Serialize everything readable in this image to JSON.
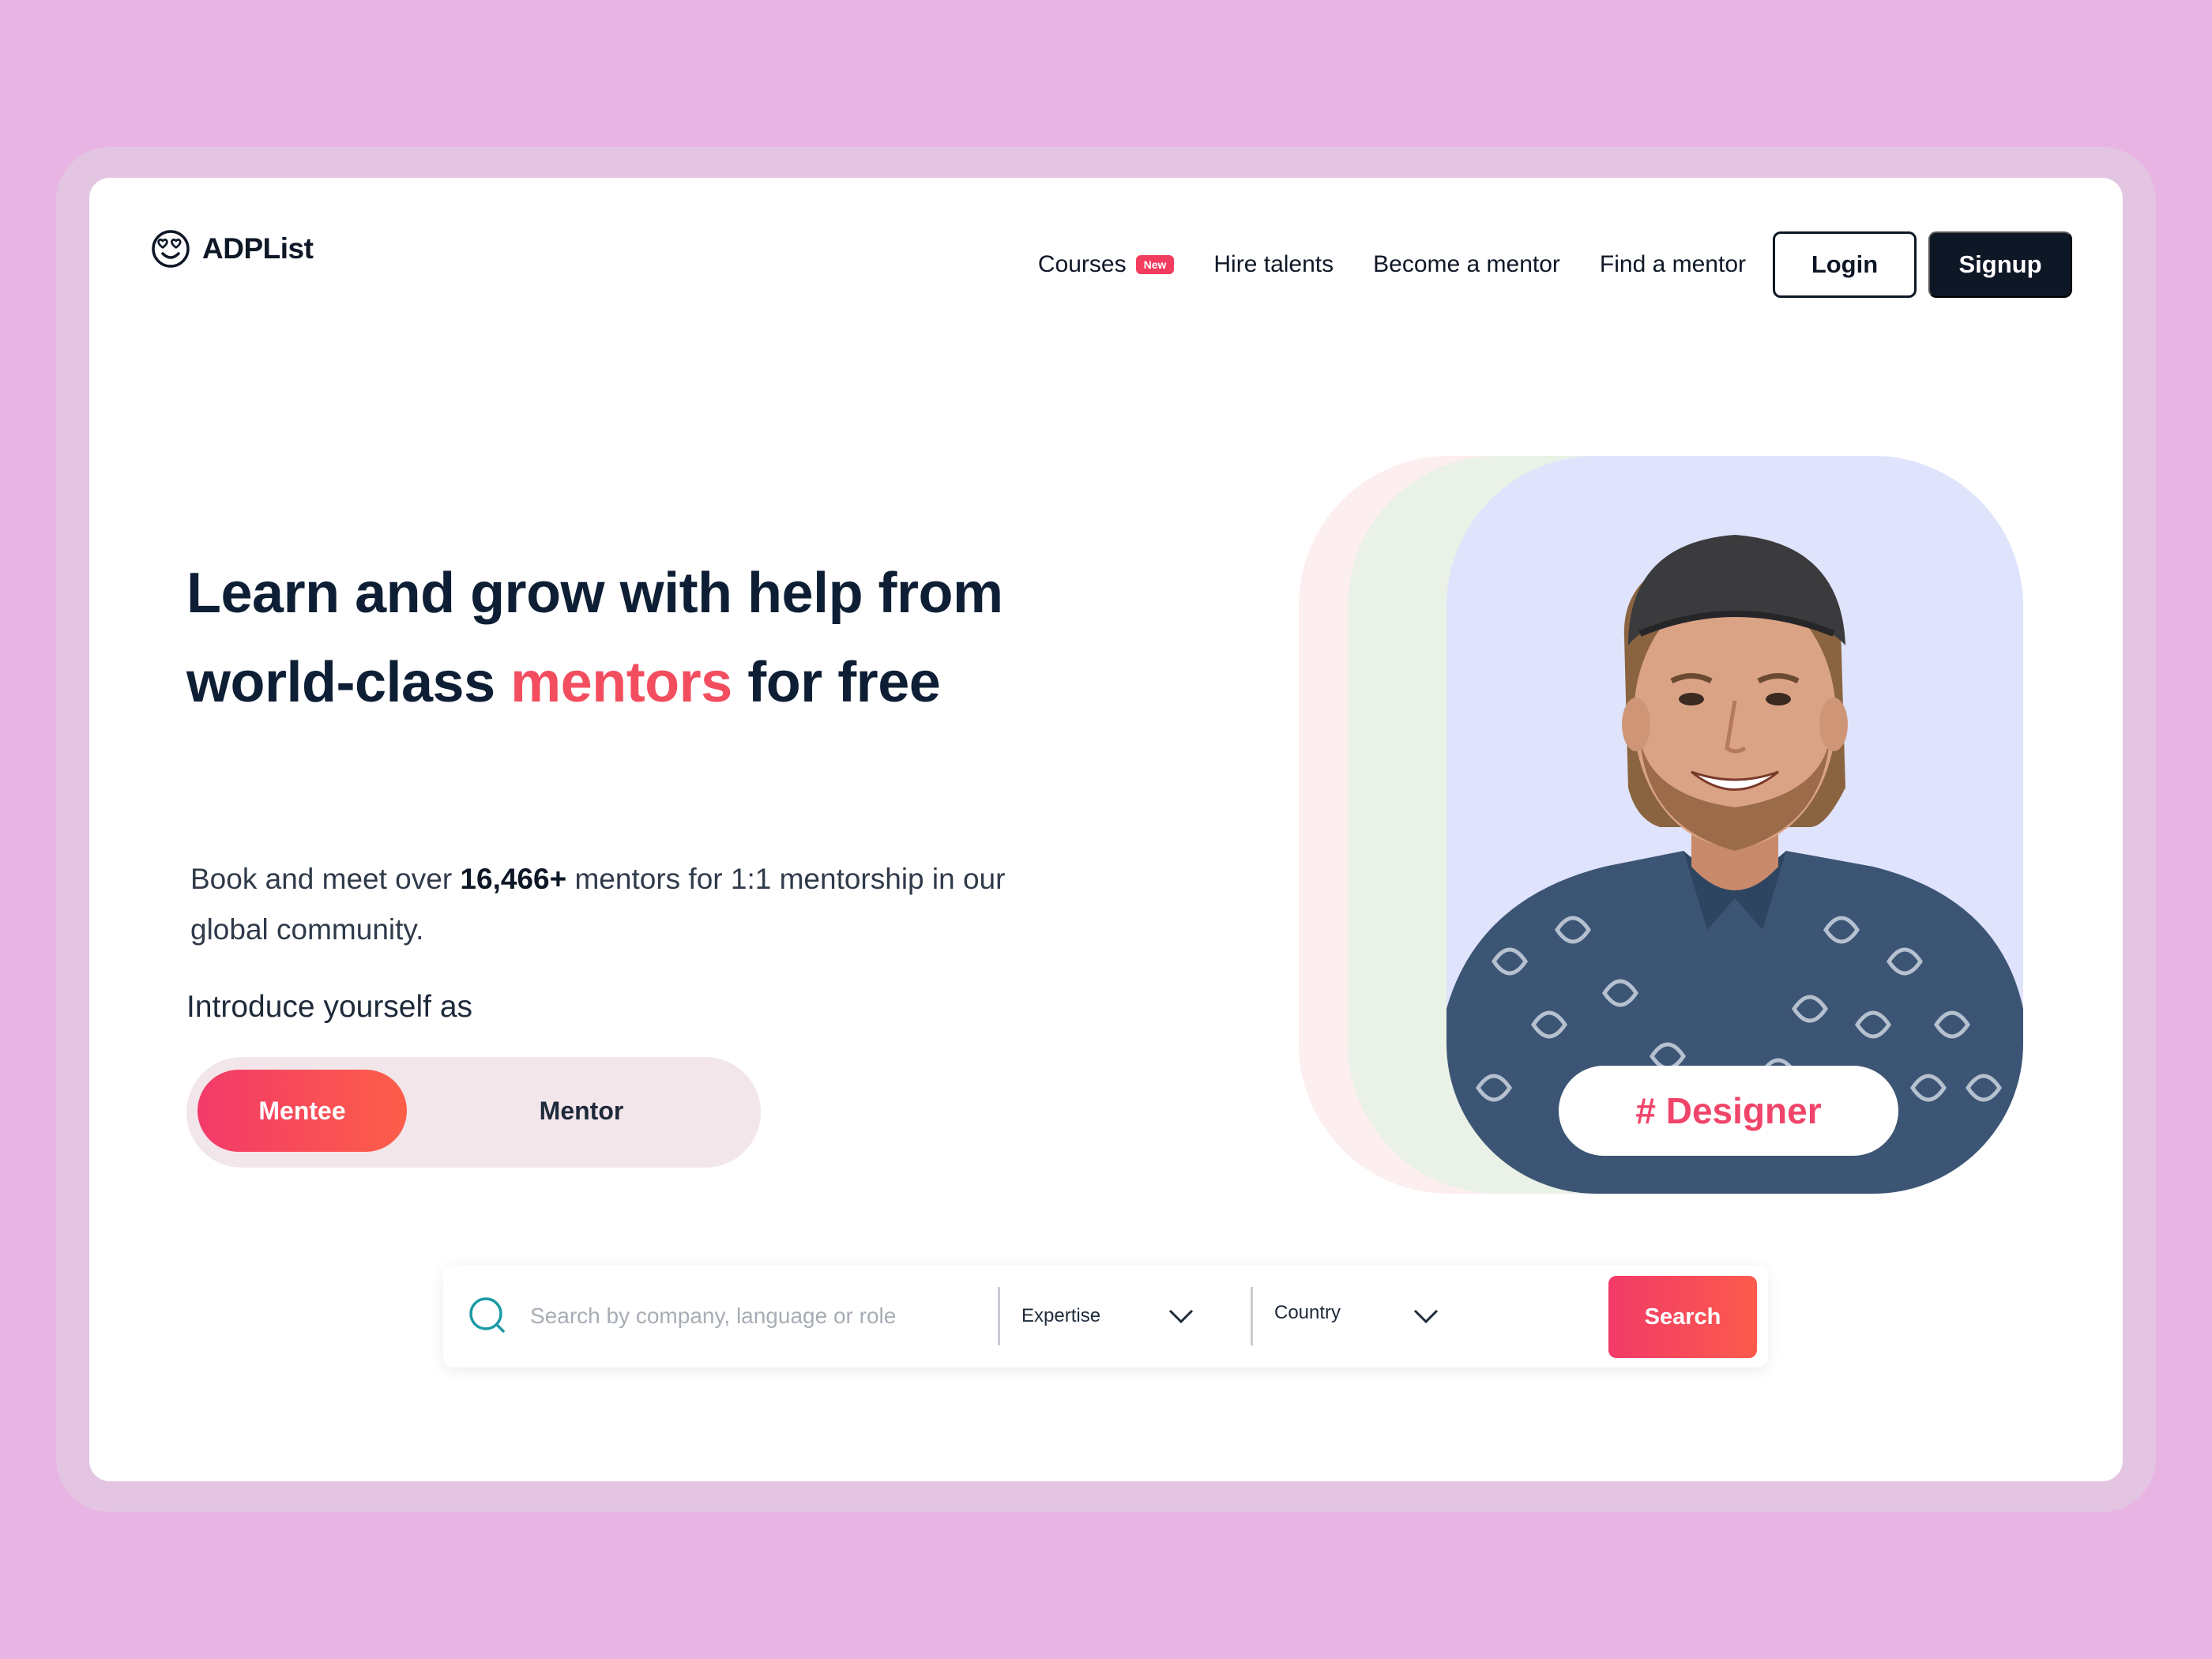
{
  "brand": {
    "name": "ADPList"
  },
  "nav": {
    "items": [
      {
        "label": "Courses",
        "badge": "New"
      },
      {
        "label": "Hire talents"
      },
      {
        "label": "Become a mentor"
      },
      {
        "label": "Find a mentor"
      }
    ],
    "login_label": "Login",
    "signup_label": "Signup"
  },
  "hero": {
    "headline_part1": "Learn and grow with help from world-class ",
    "headline_accent": "mentors",
    "headline_part2": " for free",
    "sub_part1": "Book and meet over ",
    "sub_count": "16,466+",
    "sub_part2": " mentors for 1:1 mentorship in our global community.",
    "intro_label": "Introduce yourself as",
    "toggle": {
      "options": [
        "Mentee",
        "Mentor"
      ],
      "selected": "Mentee"
    },
    "role_tag": "# Designer"
  },
  "search": {
    "placeholder": "Search by company, language or role",
    "value": "",
    "expertise_label": "Expertise",
    "country_label": "Country",
    "button_label": "Search"
  },
  "colors": {
    "page_bg": "#e8b4e3",
    "accent": "#f34e5f",
    "dark": "#0e1726",
    "photo_bg": "#e0e3fc"
  }
}
